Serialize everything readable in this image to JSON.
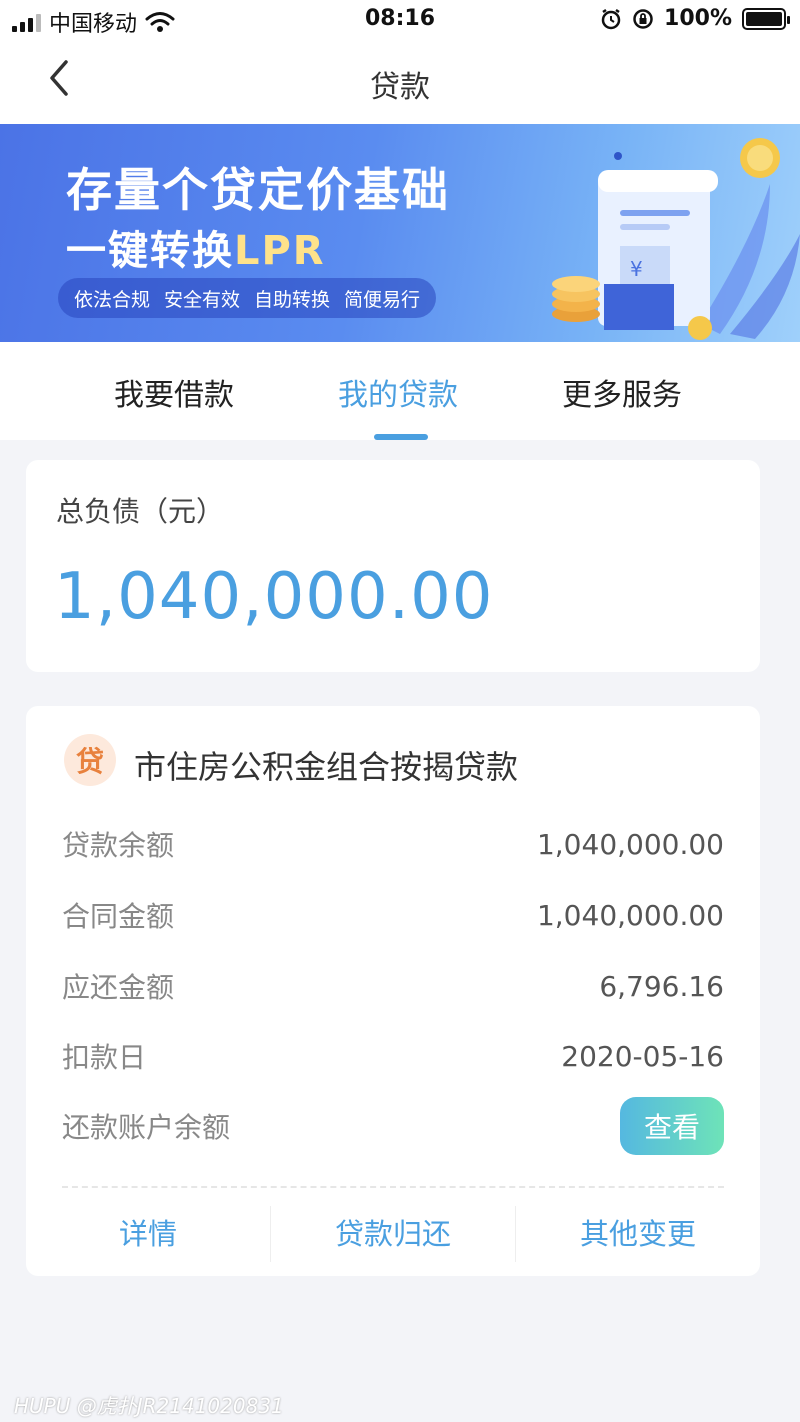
{
  "status_bar": {
    "carrier": "中国移动",
    "time": "08:16",
    "battery": "100%"
  },
  "nav": {
    "title": "贷款"
  },
  "banner": {
    "line1": "存量个贷定价基础",
    "line2_prefix": "一键转换",
    "line2_highlight": "LPR",
    "tags": [
      "依法合规",
      "安全有效",
      "自助转换",
      "简便易行"
    ]
  },
  "tabs": [
    {
      "label": "我要借款",
      "active": false
    },
    {
      "label": "我的贷款",
      "active": true
    },
    {
      "label": "更多服务",
      "active": false
    }
  ],
  "debt": {
    "label": "总负债（元）",
    "value": "1,040,000.00"
  },
  "loan": {
    "badge": "贷",
    "title": "市住房公积金组合按揭贷款",
    "rows": [
      {
        "label": "贷款余额",
        "value": "1,040,000.00"
      },
      {
        "label": "合同金额",
        "value": "1,040,000.00"
      },
      {
        "label": "应还金额",
        "value": "6,796.16"
      },
      {
        "label": "扣款日",
        "value": "2020-05-16"
      },
      {
        "label": "还款账户余额",
        "button": "查看"
      }
    ],
    "actions": [
      "详情",
      "贷款归还",
      "其他变更"
    ]
  },
  "watermark": "HUPU @虎扑JR2141020831",
  "colors": {
    "accent": "#4a9fe0",
    "badge_bg": "#fde9dc",
    "badge_fg": "#e8813d",
    "page_bg": "#f3f4f8"
  }
}
